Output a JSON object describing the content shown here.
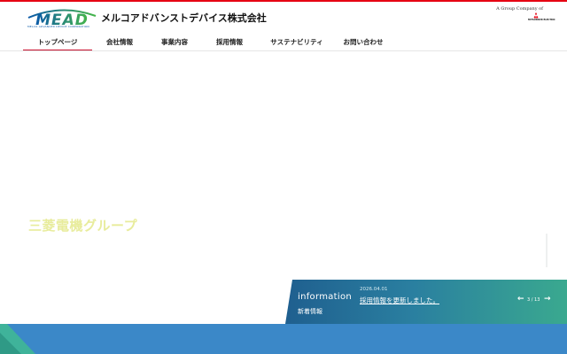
{
  "header": {
    "logo_text": "MEAD",
    "logo_subtitle": "MELCO ADVANCED DEVICE CORPORATION",
    "company_name": "メルコアドバンストデバイス株式会社",
    "group_text": "A Group Company of",
    "parent_brand": "MITSUBISHI ELECTRIC"
  },
  "nav": {
    "items": [
      {
        "label": "トップページ"
      },
      {
        "label": "会社情報"
      },
      {
        "label": "事業内容"
      },
      {
        "label": "採用情報"
      },
      {
        "label": "サステナビリティ"
      },
      {
        "label": "お問い合わせ"
      }
    ],
    "active_index": 0
  },
  "hero": {
    "text": "三菱電機グループ"
  },
  "info": {
    "title": "information",
    "subtitle": "新着情報",
    "date": "2026.04.01",
    "headline": "採用情報を更新しました。",
    "counter": "3 / 13"
  },
  "colors": {
    "accent_red": "#e60012",
    "brand_blue": "#0b5aa8",
    "brand_green": "#45b649",
    "panel_start": "#1f5f8f",
    "panel_end": "#3aa98f",
    "band_blue": "#3b88c8"
  }
}
